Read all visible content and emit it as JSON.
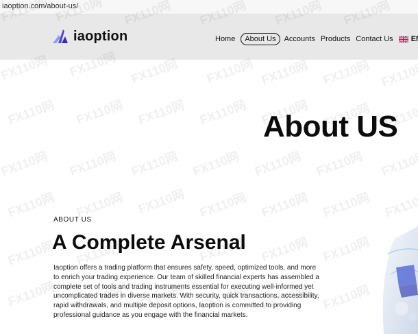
{
  "browser": {
    "url": "iaoption.com/about-us/"
  },
  "header": {
    "brand": "iaoption",
    "nav": [
      {
        "label": "Home",
        "active": false
      },
      {
        "label": "About Us",
        "active": true
      },
      {
        "label": "Accounts",
        "active": false
      },
      {
        "label": "Products",
        "active": false
      },
      {
        "label": "Contact Us",
        "active": false
      }
    ],
    "language": {
      "code": "EN",
      "flag_icon": "uk-flag-icon"
    }
  },
  "hero": {
    "title": "About US"
  },
  "about": {
    "eyebrow": "ABOUT US",
    "title": "A Complete Arsenal",
    "body": "Iaoption offers a trading platform that ensures safety, speed, optimized tools, and more to enrich your trading experience. Our team of skilled financial experts has assembled a complete set of tools and trading instruments essential for executing well-informed yet uncomplicated trades in diverse markets. With security, quick transactions, accessibility, rapid withdrawals, and multiple deposit options, Iaoption is committed to providing professional guidance as you engage with the financial markets."
  },
  "watermark": {
    "text": "FX110网"
  },
  "colors": {
    "nav_bg": "#e9e8e8",
    "logo_purple": "#5b3fd6",
    "logo_blue": "#7aa6f5",
    "text": "#111111"
  }
}
